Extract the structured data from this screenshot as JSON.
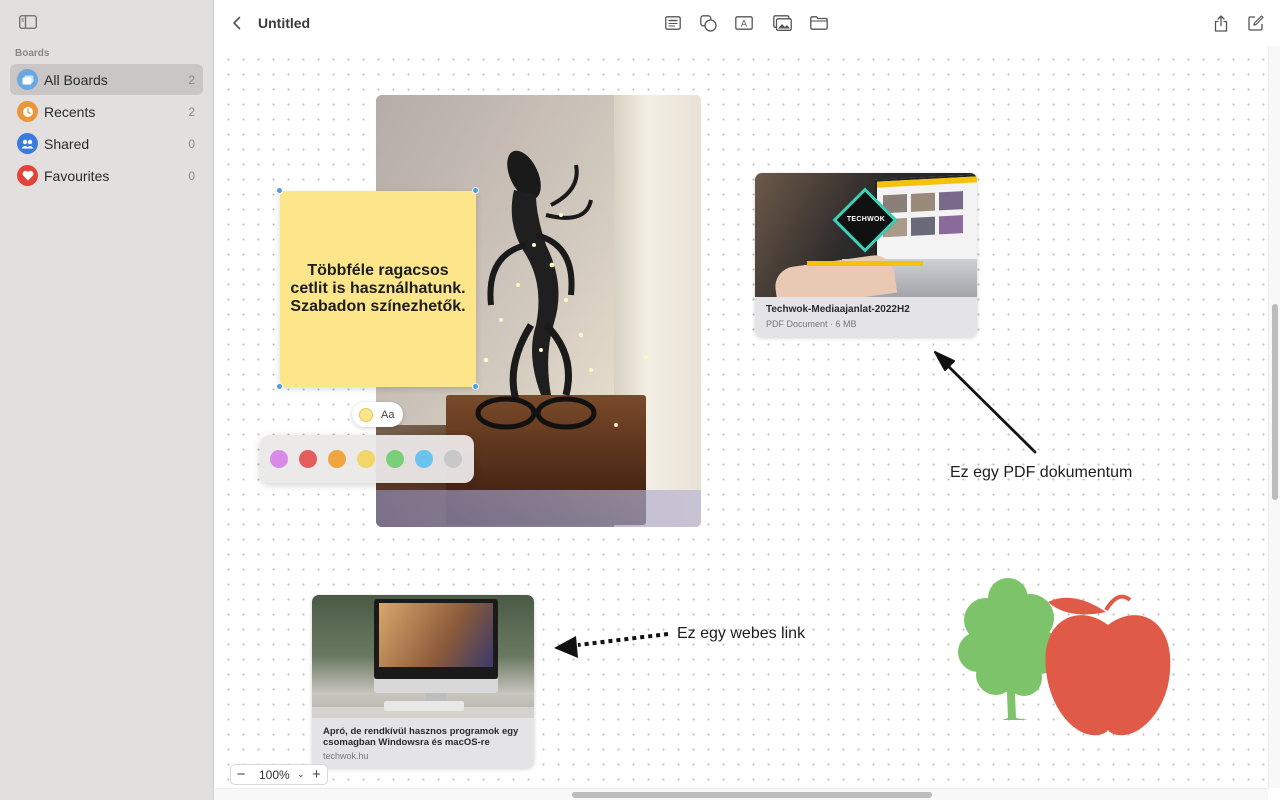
{
  "sidebar": {
    "heading": "Boards",
    "items": [
      {
        "label": "All Boards",
        "count": "2",
        "icon": "boards-icon",
        "color": "#6aa8e0"
      },
      {
        "label": "Recents",
        "count": "2",
        "icon": "clock-icon",
        "color": "#e8973a"
      },
      {
        "label": "Shared",
        "count": "0",
        "icon": "people-icon",
        "color": "#3a7be0"
      },
      {
        "label": "Favourites",
        "count": "0",
        "icon": "heart-icon",
        "color": "#e0443a"
      }
    ]
  },
  "toolbar": {
    "title": "Untitled"
  },
  "canvas": {
    "sticky_text": "Többféle ragacsos cetlit is használhatunk. Szabadon színezhetők.",
    "sticky_color": "#fde68a",
    "style_button_label": "Aa",
    "palette": [
      "#d88ae8",
      "#e35d5d",
      "#f0a640",
      "#f2d66a",
      "#7ccf7a",
      "#6cc3f0",
      "#c8c8c8"
    ],
    "pdf": {
      "title": "Techwok-Mediaajanlat-2022H2",
      "meta": "PDF Document · 6 MB",
      "logo_text": "TECHWOK"
    },
    "pdf_annotation": "Ez egy PDF dokumentum",
    "web": {
      "title": "Apró, de rendkívül hasznos programok egy csomagban Windowsra és macOS-re",
      "domain": "techwok.hu"
    },
    "web_annotation": "Ez egy webes link",
    "tree_color": "#7cc36a",
    "apple_color": "#e05a48"
  },
  "zoom": {
    "value": "100%",
    "minus": "−",
    "plus": "+"
  }
}
